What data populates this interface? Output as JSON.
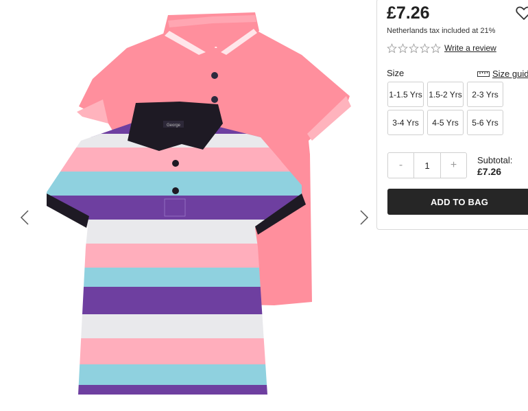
{
  "product": {
    "price": "£7.26",
    "tax_note": "Netherlands tax included at 21%",
    "review_link": "Write a review",
    "rating_stars": 0,
    "collar_tag": "George"
  },
  "size": {
    "label": "Size",
    "guide_link": "Size guid",
    "options": [
      "1-1.5 Yrs",
      "1.5-2 Yrs",
      "2-3 Yrs",
      "3-4 Yrs",
      "4-5 Yrs",
      "5-6 Yrs"
    ]
  },
  "quantity": {
    "minus": "-",
    "value": "1",
    "plus": "+"
  },
  "subtotal": {
    "label": "Subtotal:",
    "amount": "£7.26"
  },
  "actions": {
    "add_to_bag": "ADD TO BAG"
  },
  "icons": {
    "prev": "chevron-left-icon",
    "next": "chevron-right-icon",
    "wishlist": "heart-icon",
    "size_guide": "ruler-icon",
    "star": "star-outline-icon"
  },
  "colors": {
    "button_bg": "#262626",
    "shirt_pink": "#ff8f9d",
    "stripe_purple": "#6e3fa0",
    "stripe_blue": "#8fd1df",
    "stripe_pink": "#ffaebc",
    "stripe_white": "#e9e9ec",
    "collar_black": "#1e1a24"
  }
}
